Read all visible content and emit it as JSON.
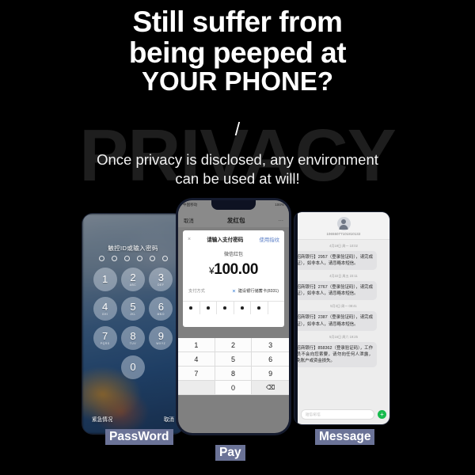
{
  "poster": {
    "background_color": "#000000",
    "headline": {
      "line1": "Still suffer from",
      "line2": "being peeped at",
      "line3": "YOUR PHONE?"
    },
    "divider_glyph": "/",
    "watermark_text": "PRIVACY",
    "watermark_color": "#1e1e1e",
    "subhead": {
      "line1": "Once privacy is disclosed, any environment",
      "line2": "can be used at will!"
    }
  },
  "captions": {
    "password": "PassWord",
    "pay": "Pay",
    "message": "Message",
    "highlight_color": "#6b7397"
  },
  "phone_left": {
    "screen_type": "ios-lock-screen",
    "prompt": "触控ID或输入密码",
    "passcode_dots": 6,
    "keys": [
      {
        "digit": "1",
        "letters": ""
      },
      {
        "digit": "2",
        "letters": "ABC"
      },
      {
        "digit": "3",
        "letters": "DEF"
      },
      {
        "digit": "4",
        "letters": "GHI"
      },
      {
        "digit": "5",
        "letters": "JKL"
      },
      {
        "digit": "6",
        "letters": "MNO"
      },
      {
        "digit": "7",
        "letters": "PQRS"
      },
      {
        "digit": "8",
        "letters": "TUV"
      },
      {
        "digit": "9",
        "letters": "WXYZ"
      },
      {
        "digit": "0",
        "letters": ""
      }
    ],
    "emergency_label": "紧急情况",
    "cancel_label": "取消"
  },
  "phone_center": {
    "screen_type": "wechat-payment",
    "status_left": "中国移动",
    "status_right": "100%",
    "nav_cancel": "取消",
    "nav_title": "发红包",
    "nav_more": "···",
    "card": {
      "close_glyph": "×",
      "title": "请输入支付密码",
      "fingerprint_link": "使用指纹",
      "subtitle": "微信红包",
      "currency": "¥",
      "amount": "100.00",
      "pay_method_label": "支付方式",
      "pay_method_value": "建设银行储蓄卡(8331)",
      "password_dots": 5
    },
    "keypad": [
      "1",
      "2",
      "3",
      "4",
      "5",
      "6",
      "7",
      "8",
      "9",
      "",
      "0",
      "⌫"
    ]
  },
  "phone_right": {
    "screen_type": "sms-inbox",
    "sender_number": "10655077101810132",
    "messages": [
      {
        "time": "4月19日 周一 10:02",
        "text": "【招商银行】2957（登录验证码），请完成验证），如非本人，请忽略本短信。"
      },
      {
        "time": "4月22日 周五 23:11",
        "text": "【招商银行】2767（登录验证码），请完成验证），如非本人，请忽略本短信。"
      },
      {
        "time": "5月3日 周一 08:41",
        "text": "【招商银行】2387（登录验证码），请完成验证），如非本人，请忽略本短信。"
      },
      {
        "time": "5月16日 周六 19:25",
        "text": "【招商银行】858362（登录验证码），工作人员不会向您索要，请勿向任何人泄露，以免账户或资金损失。"
      }
    ],
    "input_placeholder": "短信/彩信",
    "send_plus_glyph": "+"
  }
}
